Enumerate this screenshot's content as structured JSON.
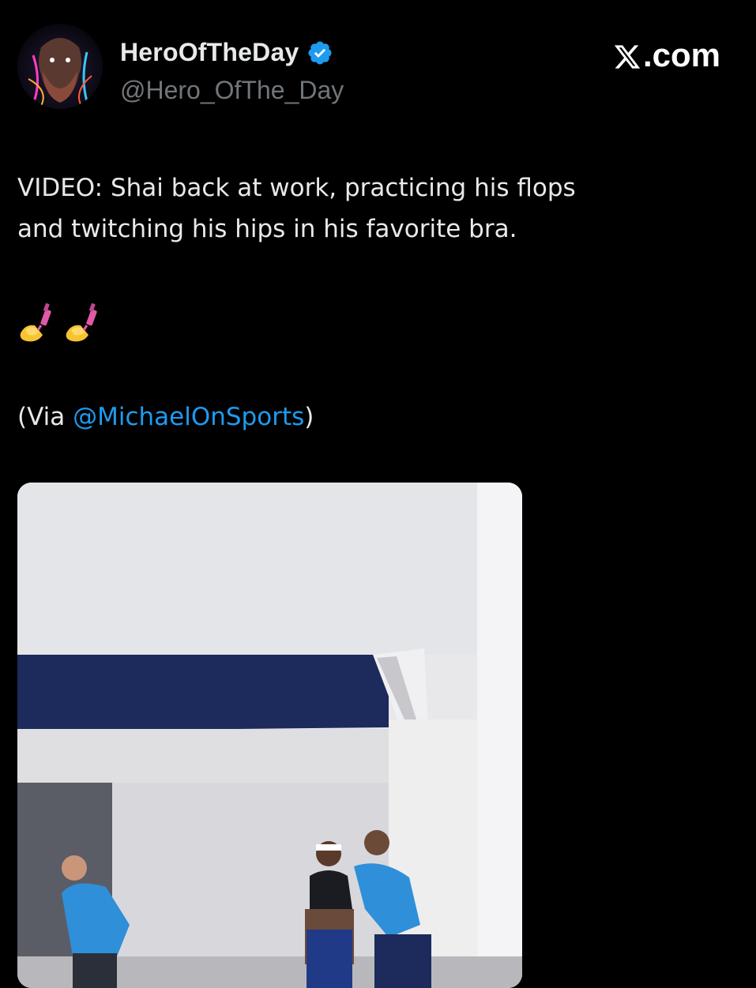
{
  "header": {
    "display_name": "HeroOfTheDay",
    "handle": "@Hero_OfThe_Day",
    "verified_icon": "verified-badge-icon",
    "site_label": ".com",
    "site_logo_icon": "x-logo-icon"
  },
  "tweet": {
    "line1": "VIDEO: Shai back at work, practicing his flops",
    "line2": "and twitching his hips in his favorite bra.",
    "emojis": [
      "nail-polish-icon",
      "nail-polish-icon"
    ],
    "via_prefix": "(Via ",
    "via_mention": "@MichaelOnSports",
    "via_suffix": ")"
  },
  "media": {
    "type": "video-still",
    "description_icon": "video-frame"
  },
  "colors": {
    "background": "#000000",
    "text": "#e7e9ea",
    "muted": "#71767b",
    "link": "#1d9bf0",
    "verified": "#1d9bf0"
  }
}
